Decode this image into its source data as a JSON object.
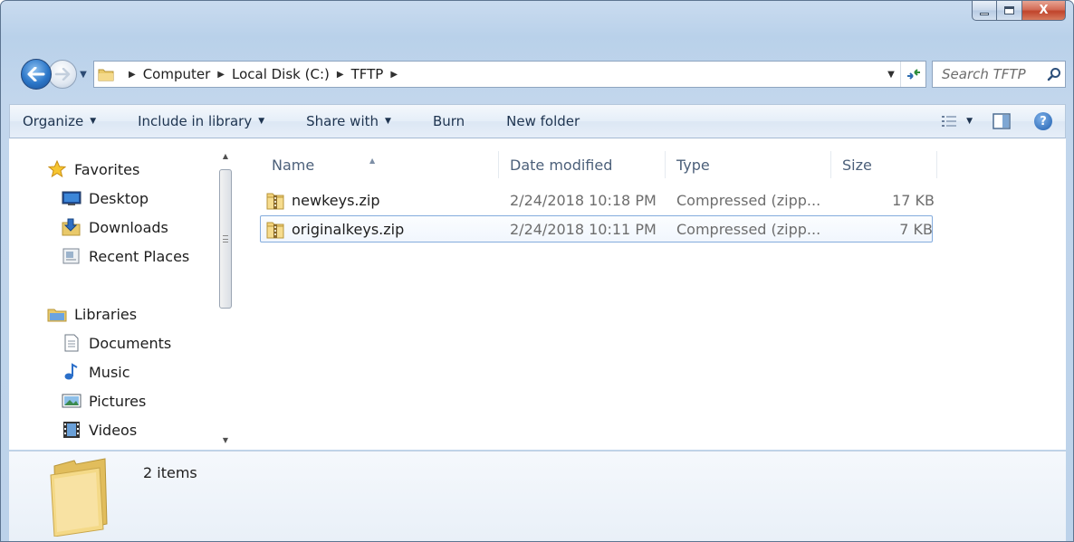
{
  "window": {
    "close_label": "X"
  },
  "address_bar": {
    "crumbs": [
      "Computer",
      "Local Disk (C:)",
      "TFTP"
    ]
  },
  "search": {
    "placeholder": "Search TFTP"
  },
  "toolbar": {
    "organize": "Organize",
    "include_in_library": "Include in library",
    "share_with": "Share with",
    "burn": "Burn",
    "new_folder": "New folder",
    "help": "?"
  },
  "nav_pane": {
    "favorites": {
      "label": "Favorites",
      "items": [
        "Desktop",
        "Downloads",
        "Recent Places"
      ]
    },
    "libraries": {
      "label": "Libraries",
      "items": [
        "Documents",
        "Music",
        "Pictures",
        "Videos"
      ]
    }
  },
  "file_list": {
    "columns": [
      "Name",
      "Date modified",
      "Type",
      "Size"
    ],
    "sorted_by": "Name",
    "rows": [
      {
        "name": "newkeys.zip",
        "date_modified": "2/24/2018 10:18 PM",
        "type": "Compressed (zipp...",
        "size": "17 KB",
        "selected": false
      },
      {
        "name": "originalkeys.zip",
        "date_modified": "2/24/2018 10:11 PM",
        "type": "Compressed (zipp...",
        "size": "7 KB",
        "selected": true
      }
    ]
  },
  "details_pane": {
    "item_count": "2 items"
  },
  "colors": {
    "frame": "#bcd2ea",
    "selection_border": "#84acdd",
    "close_button": "#c0442b"
  }
}
